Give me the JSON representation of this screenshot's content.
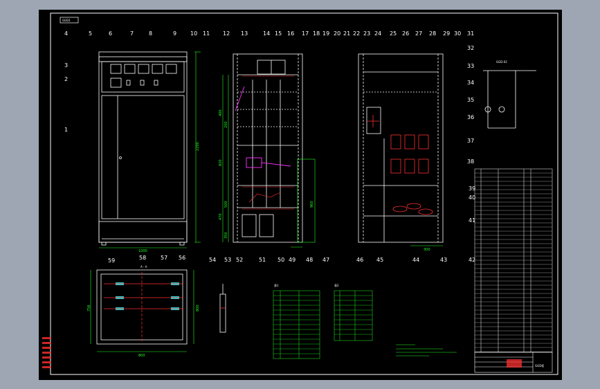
{
  "colors": {
    "background": "#9ea6b4",
    "sheet": "#000000",
    "frame": "#ffffff",
    "dimension": "#22ff22",
    "wiring": "#ff3030",
    "highlight": "#ff33ff",
    "busbar": "#33cccc",
    "accent": "#ffff33"
  },
  "callouts_front": [
    "1",
    "2",
    "3",
    "4",
    "5",
    "6",
    "7",
    "8",
    "9",
    "10"
  ],
  "callouts_middle_top": [
    "11",
    "12",
    "13",
    "14",
    "15",
    "16",
    "17",
    "18",
    "19",
    "20",
    "21"
  ],
  "callouts_middle_bottom": [
    "52",
    "51",
    "50",
    "49",
    "48",
    "47"
  ],
  "callouts_side_top": [
    "22",
    "23",
    "24",
    "25",
    "26",
    "27",
    "28",
    "29",
    "30",
    "31"
  ],
  "callouts_side_right": [
    "32",
    "33",
    "34",
    "35",
    "36",
    "37",
    "38",
    "39",
    "40",
    "41",
    "42"
  ],
  "callouts_side_bottom": [
    "46",
    "45",
    "44",
    "43"
  ],
  "callouts_plan": [
    "59",
    "58",
    "57",
    "56"
  ],
  "callouts_detail": [
    "54",
    "53"
  ],
  "dimensions": {
    "front_width": "1000",
    "front_height": "2200",
    "plan_width": "800",
    "plan_depth_left": "756",
    "plan_depth_right": "800",
    "side_bottom": "300",
    "middle_right": "960",
    "middle_left_values": [
      "400",
      "200",
      "820",
      "500",
      "470",
      "350"
    ]
  },
  "header_tag": "GGD1",
  "circuit_label": "GGD-02",
  "plan_label": "A - A",
  "table_titles": [
    "表1",
    "表2"
  ],
  "title_block_caption": "GGD柜"
}
